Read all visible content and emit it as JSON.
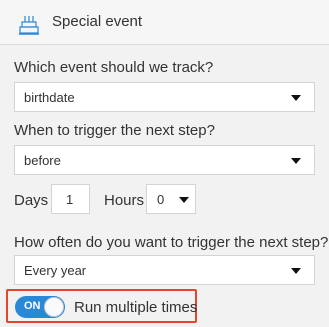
{
  "header": {
    "title": "Special event",
    "icon": "cake-icon"
  },
  "event": {
    "label": "Which event should we track?",
    "value": "birthdate"
  },
  "trigger": {
    "label": "When to trigger the next step?",
    "value": "before"
  },
  "offset": {
    "days_label": "Days",
    "days_value": "1",
    "hours_label": "Hours",
    "hours_value": "0"
  },
  "frequency": {
    "label": "How often do you want to trigger the next step?",
    "value": "Every year"
  },
  "repeat_toggle": {
    "state_label": "ON",
    "label": "Run multiple times"
  },
  "colors": {
    "accent": "#2a89d6",
    "highlight": "#e5452a"
  }
}
